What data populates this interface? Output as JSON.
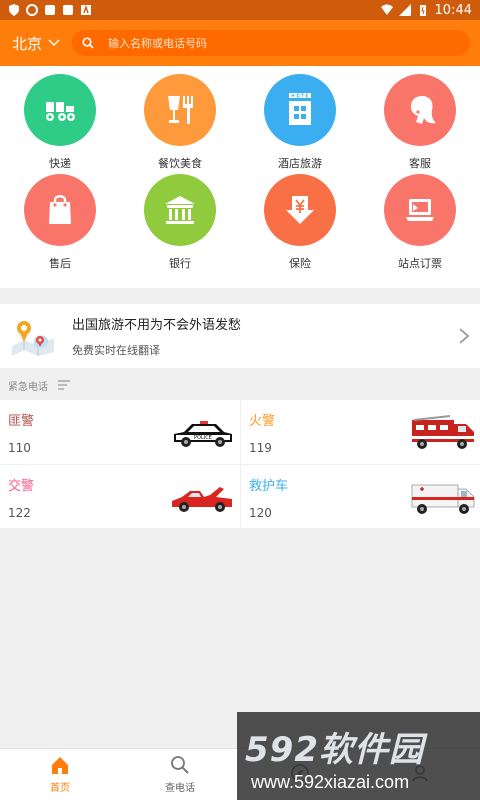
{
  "status_bar": {
    "time": "10:44"
  },
  "colors": {
    "accent": "#ff7d0a",
    "statusbar": "#cf5c0c"
  },
  "header": {
    "city": "北京",
    "search_placeholder": "输入名称或电话号码"
  },
  "services": [
    {
      "label": "快递",
      "icon": "delivery-truck-icon",
      "color": "#2ecc86"
    },
    {
      "label": "餐饮美食",
      "icon": "food-drink-icon",
      "color": "#ff9a3c"
    },
    {
      "label": "酒店旅游",
      "icon": "hotel-icon",
      "color": "#3aaef0"
    },
    {
      "label": "客服",
      "icon": "customer-service-icon",
      "color": "#fa7569"
    },
    {
      "label": "售后",
      "icon": "shopping-bag-icon",
      "color": "#fa7569"
    },
    {
      "label": "银行",
      "icon": "bank-icon",
      "color": "#8fcb3c"
    },
    {
      "label": "保险",
      "icon": "insurance-yen-icon",
      "color": "#fa7046"
    },
    {
      "label": "站点订票",
      "icon": "ticket-laptop-icon",
      "color": "#fa7569"
    }
  ],
  "banner": {
    "title": "出国旅游不用为不会外语发愁",
    "subtitle": "免费实时在线翻译",
    "icon": "travel-map-icon"
  },
  "emergency": {
    "heading": "紧急电话",
    "items": [
      {
        "name": "匪警",
        "number": "110",
        "color": "#b4524a",
        "icon": "police-car-icon"
      },
      {
        "name": "火警",
        "number": "119",
        "color": "#ff9a1e",
        "icon": "fire-truck-icon"
      },
      {
        "name": "交警",
        "number": "122",
        "color": "#ff5c8a",
        "icon": "traffic-police-car-icon"
      },
      {
        "name": "救护车",
        "number": "120",
        "color": "#3aaef0",
        "icon": "ambulance-icon"
      }
    ]
  },
  "tabs": [
    {
      "label": "首页",
      "icon": "home-icon",
      "active": true
    },
    {
      "label": "查电话",
      "icon": "search-phone-icon",
      "active": false
    },
    {
      "label": "",
      "icon": "discover-icon",
      "active": false
    },
    {
      "label": "",
      "icon": "profile-icon",
      "active": false
    }
  ],
  "watermark": {
    "main": "592软件园",
    "sub": "www.592xiazai.com"
  }
}
